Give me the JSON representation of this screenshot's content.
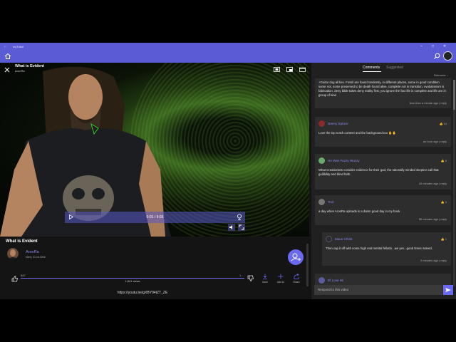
{
  "window": {
    "title": "myTube!",
    "back_icon": "back-arrow-icon",
    "accent": "#5b5bd6"
  },
  "video": {
    "title": "What is Evident",
    "channel": "AronRa",
    "time_display": "0:01 / 9:03",
    "toolbar_icons": [
      "cast-icon",
      "picture-in-picture-icon",
      "open-external-icon"
    ],
    "mini_icons": [
      "mute-icon",
      "fullscreen-icon"
    ]
  },
  "info": {
    "title": "What is Evident",
    "channel_name": "AronRa",
    "channel_meta": "Ndnl | 01.26.2006",
    "likes": "587",
    "dislikes": "1",
    "views": "1,841 views",
    "rating": {
      "likes": 587,
      "dislikes": 1
    },
    "actions": [
      {
        "label": "Save"
      },
      {
        "label": "Add to"
      },
      {
        "label": "Share"
      }
    ],
    "url": "https://youtu.be/gXBY94tZT_ZE"
  },
  "comments_panel": {
    "tabs": [
      "Comments",
      "Suggested"
    ],
    "active_tab": "Comments",
    "sort_label": "Relevance",
    "comments": [
      {
        "author": "",
        "text": "+Guitar dog all lies. Fossil are found randomly, in different places, some in good condition some not, some preserved to be death found alive, complete not in transition, evolutionism is fabrication, deny bible takes deny reality first; you ignore the fact life is complete and life are in group of kind",
        "time": "less than a minute ago",
        "reply": "reply"
      },
      {
        "author": "Danny Spitzer",
        "likes": "14",
        "text": "Love the top notch content and the  background too ✋✋",
        "time": "an hour ago",
        "reply": "reply"
      },
      {
        "author": "He Was Fuzzy Wuzzy",
        "likes": "8",
        "text": "What Creationists consider evidence for their god, the rationally minded skeptics call that gullibility and blind faith.",
        "time": "43 minutes ago",
        "reply": "reply"
      },
      {
        "author": "Tool",
        "likes": "3",
        "text": "a day when AronRa uploads is a damn good day in my book",
        "time": "56 minutes ago",
        "reply": "reply"
      },
      {
        "author": "Maus Christ",
        "likes": "1",
        "text": "Then cap it off with some high end mental fellatio...aw yes...good times indeed.",
        "time": "2 minutes ago",
        "reply": "reply"
      },
      {
        "author": "Ef Love Mi",
        "likes": "",
        "text": "",
        "time": "",
        "reply": ""
      }
    ],
    "reply_placeholder": "Respond to this video"
  }
}
